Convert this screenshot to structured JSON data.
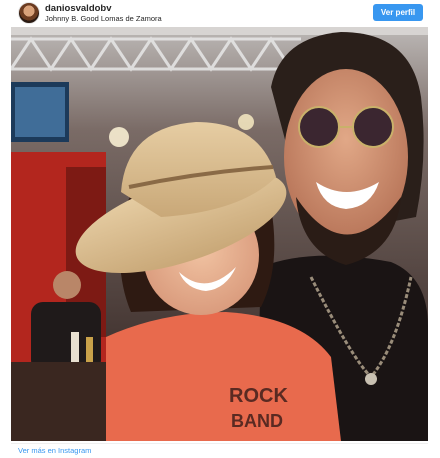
{
  "post": {
    "username": "daniosvaldobv",
    "location": "Johnny B. Good Lomas de Zamora",
    "view_profile_label": "Ver perfil",
    "footer_link": "Ver más en Instagram",
    "shirt_text_1": "ROCK",
    "shirt_text_2": "BAND"
  },
  "colors": {
    "accent": "#3897f0",
    "text": "#262626"
  },
  "icons": {
    "avatar": "profile-avatar"
  }
}
